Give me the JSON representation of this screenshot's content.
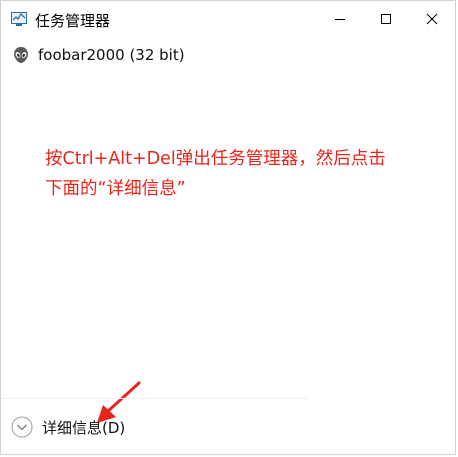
{
  "window": {
    "title": "任务管理器",
    "minimize_label": "",
    "maximize_label": "",
    "close_label": ""
  },
  "process": {
    "name": "foobar2000 (32 bit)",
    "icon": "alien-head-icon"
  },
  "annotation": {
    "line1": "按Ctrl+Alt+Del弹出任务管理器，然后点击",
    "line2": "下面的“详细信息”",
    "color": "#e8241b"
  },
  "footer": {
    "details_label": "详细信息(D)",
    "icon": "chevron-down-circle-icon"
  }
}
